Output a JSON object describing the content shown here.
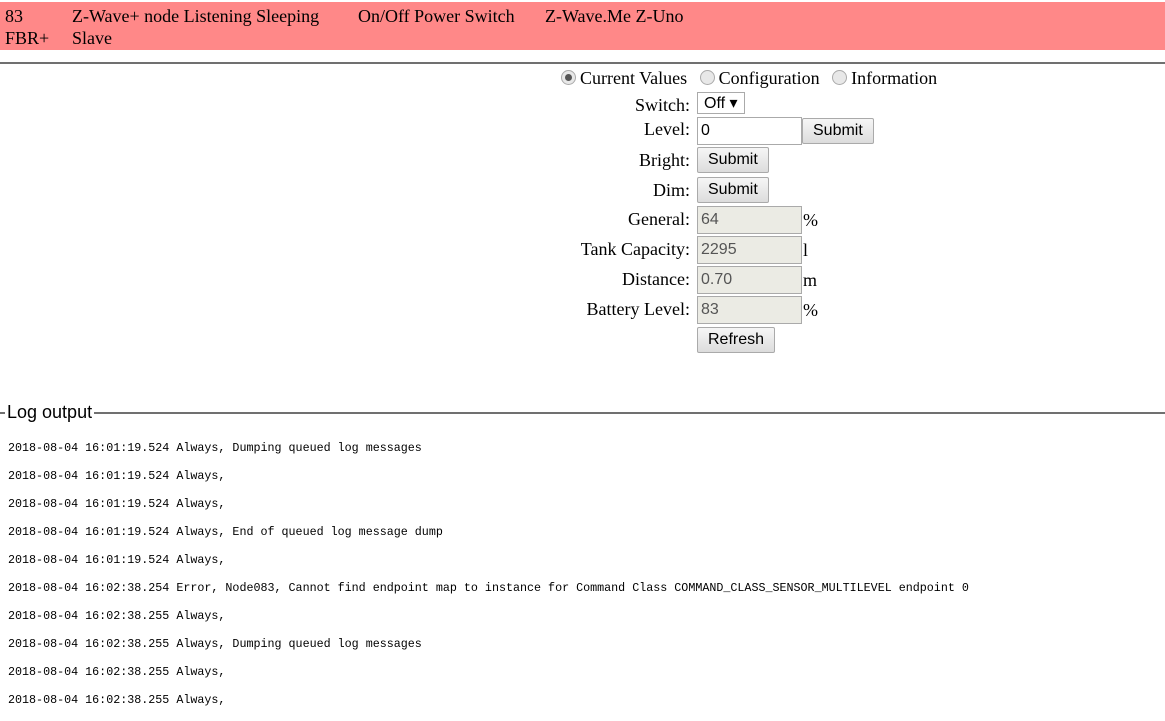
{
  "node": {
    "id": "83",
    "description": "Z-Wave+ node Listening Sleeping",
    "type": "On/Off Power Switch",
    "product": "Z-Wave.Me Z-Uno",
    "basic": "FBR+",
    "role": "Slave",
    "color": "#ff8888"
  },
  "tabs": [
    {
      "label": "Current Values",
      "selected": true
    },
    {
      "label": "Configuration",
      "selected": false
    },
    {
      "label": "Information",
      "selected": false
    }
  ],
  "values": {
    "switch": {
      "label": "Switch:",
      "value": "Off ▾"
    },
    "level": {
      "label": "Level:",
      "value": "0",
      "button": "Submit"
    },
    "bright": {
      "label": "Bright:",
      "button": "Submit"
    },
    "dim": {
      "label": "Dim:",
      "button": "Submit"
    },
    "general": {
      "label": "General:",
      "value": "64",
      "unit": "%"
    },
    "tank": {
      "label": "Tank Capacity:",
      "value": "2295",
      "unit": "l"
    },
    "distance": {
      "label": "Distance:",
      "value": "0.70",
      "unit": "m"
    },
    "battery": {
      "label": "Battery Level:",
      "value": "83",
      "unit": "%"
    },
    "refresh": "Refresh"
  },
  "log": {
    "title": "Log output",
    "lines": [
      "2018-08-04 16:01:19.524 Always, Dumping queued log messages",
      "2018-08-04 16:01:19.524 Always,",
      "2018-08-04 16:01:19.524 Always,",
      "2018-08-04 16:01:19.524 Always, End of queued log message dump",
      "2018-08-04 16:01:19.524 Always,",
      "2018-08-04 16:02:38.254 Error, Node083, Cannot find endpoint map to instance for Command Class COMMAND_CLASS_SENSOR_MULTILEVEL endpoint 0",
      "2018-08-04 16:02:38.255 Always,",
      "2018-08-04 16:02:38.255 Always, Dumping queued log messages",
      "2018-08-04 16:02:38.255 Always,",
      "2018-08-04 16:02:38.255 Always,"
    ]
  }
}
